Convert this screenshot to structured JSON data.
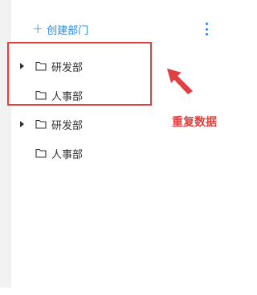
{
  "header": {
    "create_label": "创建部门",
    "more_icon": "more-vertical-icon"
  },
  "tree": [
    {
      "label": "研发部",
      "expandable": true
    },
    {
      "label": "人事部",
      "expandable": false
    },
    {
      "label": "研发部",
      "expandable": true
    },
    {
      "label": "人事部",
      "expandable": false
    }
  ],
  "annotation": {
    "text": "重复数据",
    "color": "#e0403f"
  },
  "colors": {
    "accent": "#2d87e2",
    "annotation": "#e0403f"
  }
}
